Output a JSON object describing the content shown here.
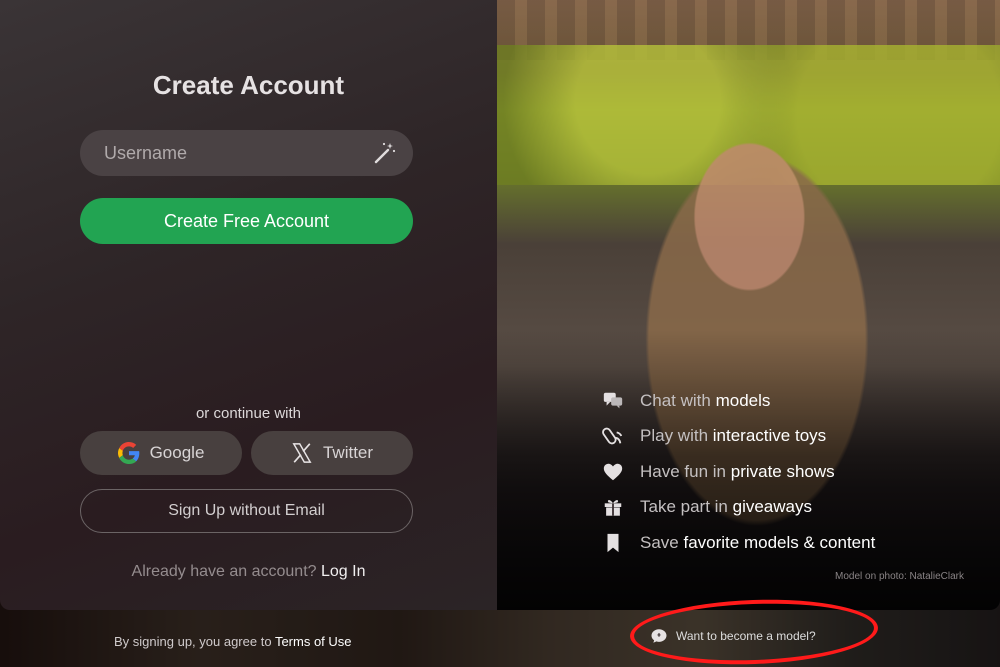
{
  "signup": {
    "title": "Create Account",
    "username_placeholder": "Username",
    "create_button": "Create Free Account",
    "or_continue": "or continue with",
    "google_label": "Google",
    "twitter_label": "Twitter",
    "no_email_label": "Sign Up without Email",
    "already_text": "Already have an account?",
    "login_label": "Log In"
  },
  "features": [
    {
      "icon": "chat-bubbles-icon",
      "pre": "Chat with",
      "highlight": "models",
      "post": ""
    },
    {
      "icon": "toys-icon",
      "pre": "Play with",
      "highlight": "interactive toys",
      "post": ""
    },
    {
      "icon": "heart-icon",
      "pre": "Have fun in",
      "highlight": "private shows",
      "post": ""
    },
    {
      "icon": "gift-icon",
      "pre": "Take part in",
      "highlight": "giveaways",
      "post": ""
    },
    {
      "icon": "bookmark-icon",
      "pre": "Save",
      "highlight": "favorite models & content",
      "post": ""
    }
  ],
  "photo_credit": "Model on photo: NatalieClark",
  "footer": {
    "terms_prefix": "By signing up, you agree to",
    "terms_link": "Terms of Use",
    "become_model": "Want to become a model?"
  },
  "colors": {
    "accent_green": "#22a452",
    "annotation_red": "#ff1a1a"
  }
}
